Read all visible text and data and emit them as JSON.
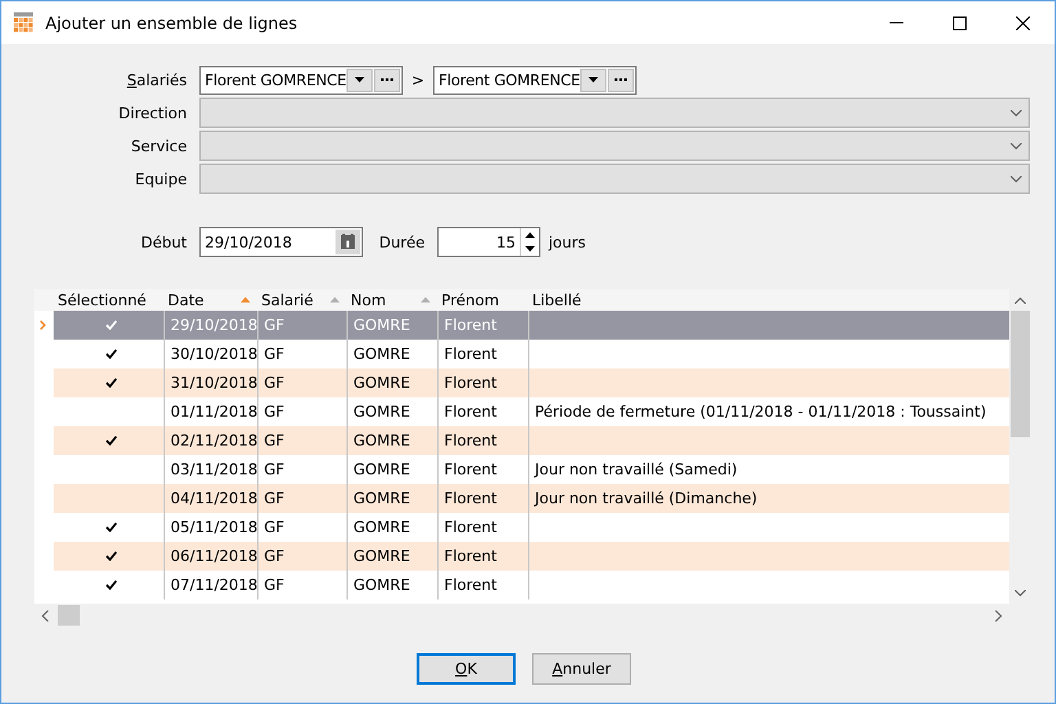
{
  "window": {
    "title": "Ajouter un ensemble de lignes"
  },
  "filters": {
    "employees": {
      "label": "Salariés",
      "mnemonic": true,
      "from": "Florent GOMRENCE",
      "separator": ">",
      "to": "Florent GOMRENCE"
    },
    "combos": [
      {
        "label": "Direction",
        "disabled": true
      },
      {
        "label": "Service",
        "disabled": true
      },
      {
        "label": "Equipe",
        "disabled": true
      }
    ],
    "start": {
      "label": "Début",
      "value": "29/10/2018"
    },
    "duration": {
      "label": "Durée",
      "value": "15",
      "unit": "jours"
    }
  },
  "table": {
    "columns": [
      {
        "label": "Sélectionné",
        "sort_arrow": false
      },
      {
        "label": "Date",
        "sort_arrow": true,
        "sort_active": true
      },
      {
        "label": "Salarié",
        "sort_arrow": true,
        "sort_active": false
      },
      {
        "label": "Nom",
        "sort_arrow": true,
        "sort_active": false
      },
      {
        "label": "Prénom",
        "sort_arrow": false
      },
      {
        "label": "Libellé",
        "sort_arrow": false
      }
    ],
    "rows": [
      {
        "current": true,
        "selected": true,
        "date": "29/10/2018",
        "employee": "GF",
        "name": "GOMRE",
        "first_name": "Florent"
      },
      {
        "current": false,
        "selected": true,
        "date": "30/10/2018",
        "employee": "GF",
        "name": "GOMRE",
        "first_name": "Florent"
      },
      {
        "current": false,
        "selected": true,
        "date": "31/10/2018",
        "employee": "GF",
        "name": "GOMRE",
        "first_name": "Florent"
      },
      {
        "current": false,
        "selected": false,
        "date": "01/11/2018",
        "employee": "GF",
        "name": "GOMRE",
        "first_name": "Florent",
        "label": "Période de fermeture (01/11/2018 - 01/11/2018 : Toussaint)"
      },
      {
        "current": false,
        "selected": true,
        "date": "02/11/2018",
        "employee": "GF",
        "name": "GOMRE",
        "first_name": "Florent"
      },
      {
        "current": false,
        "selected": false,
        "date": "03/11/2018",
        "employee": "GF",
        "name": "GOMRE",
        "first_name": "Florent",
        "label": "Jour non travaillé (Samedi)"
      },
      {
        "current": false,
        "selected": false,
        "date": "04/11/2018",
        "employee": "GF",
        "name": "GOMRE",
        "first_name": "Florent",
        "label": "Jour non travaillé (Dimanche)"
      },
      {
        "current": false,
        "selected": true,
        "date": "05/11/2018",
        "employee": "GF",
        "name": "GOMRE",
        "first_name": "Florent"
      },
      {
        "current": false,
        "selected": true,
        "date": "06/11/2018",
        "employee": "GF",
        "name": "GOMRE",
        "first_name": "Florent"
      },
      {
        "current": false,
        "selected": true,
        "date": "07/11/2018",
        "employee": "GF",
        "name": "GOMRE",
        "first_name": "Florent"
      }
    ]
  },
  "buttons": [
    {
      "label": "OK",
      "mnemonic": true,
      "default": true
    },
    {
      "label": "Annuler",
      "mnemonic": true,
      "default": false
    }
  ]
}
